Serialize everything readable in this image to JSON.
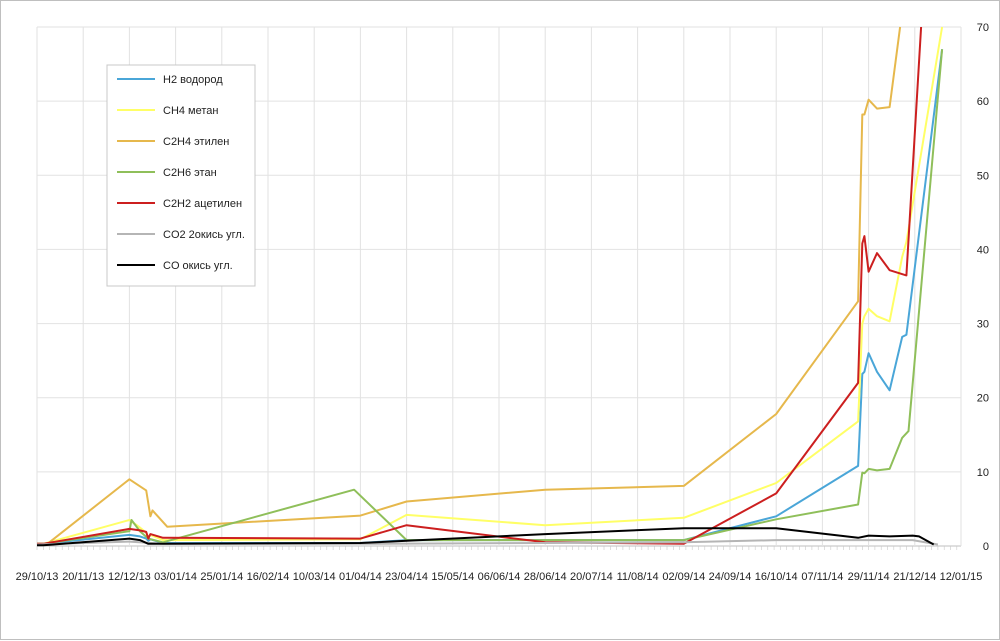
{
  "chart_data": {
    "type": "line",
    "title": "",
    "xlabel": "",
    "ylabel": "",
    "ylim": [
      0,
      70
    ],
    "yticks": [
      0,
      10,
      20,
      30,
      40,
      50,
      60,
      70
    ],
    "y_axis_side": "right",
    "grid": true,
    "legend_position": "top-left",
    "x_tick_labels": [
      "29/10/13",
      "20/11/13",
      "12/12/13",
      "03/01/14",
      "25/01/14",
      "16/02/14",
      "10/03/14",
      "01/04/14",
      "23/04/14",
      "15/05/14",
      "06/06/14",
      "28/06/14",
      "20/07/14",
      "11/08/14",
      "02/09/14",
      "24/09/14",
      "16/10/14",
      "07/11/14",
      "29/11/14",
      "21/12/14",
      "12/01/15"
    ],
    "series": [
      {
        "name": "H2 водород",
        "color": "#4aa6d8",
        "points": [
          [
            "2013-10-29",
            0.3
          ],
          [
            "2013-11-01",
            0.3
          ],
          [
            "2013-12-12",
            1.5
          ],
          [
            "2013-12-17",
            1.3
          ],
          [
            "2013-12-20",
            1.0
          ],
          [
            "2013-12-21",
            0.7
          ],
          [
            "2013-12-22",
            0.9
          ],
          [
            "2013-12-28",
            0.4
          ],
          [
            "2014-04-01",
            0.4
          ],
          [
            "2014-04-23",
            0.8
          ],
          [
            "2014-09-02",
            0.8
          ],
          [
            "2014-10-16",
            4.0
          ],
          [
            "2014-11-24",
            10.8
          ],
          [
            "2014-11-26",
            23.2
          ],
          [
            "2014-11-27",
            23.5
          ],
          [
            "2014-11-29",
            26.0
          ],
          [
            "2014-12-03",
            23.5
          ],
          [
            "2014-12-09",
            21.0
          ],
          [
            "2014-12-15",
            28.2
          ],
          [
            "2014-12-17",
            28.5
          ],
          [
            "2015-01-03",
            67.0
          ]
        ]
      },
      {
        "name": "CH4 метан",
        "color": "#ffff66",
        "points": [
          [
            "2013-10-29",
            0.3
          ],
          [
            "2013-11-01",
            0.3
          ],
          [
            "2013-12-12",
            3.5
          ],
          [
            "2013-12-17",
            2.5
          ],
          [
            "2013-12-20",
            1.8
          ],
          [
            "2013-12-21",
            1.2
          ],
          [
            "2013-12-22",
            1.5
          ],
          [
            "2013-12-28",
            0.8
          ],
          [
            "2014-04-01",
            0.9
          ],
          [
            "2014-04-23",
            4.2
          ],
          [
            "2014-06-28",
            2.8
          ],
          [
            "2014-09-02",
            3.8
          ],
          [
            "2014-10-16",
            8.5
          ],
          [
            "2014-11-24",
            16.8
          ],
          [
            "2014-11-26",
            30.0
          ],
          [
            "2014-11-27",
            31.0
          ],
          [
            "2014-11-29",
            32.0
          ],
          [
            "2014-12-03",
            31.0
          ],
          [
            "2014-12-09",
            30.3
          ],
          [
            "2014-12-15",
            39.0
          ],
          [
            "2014-12-17",
            41.0
          ],
          [
            "2015-01-03",
            70.0
          ]
        ]
      },
      {
        "name": "C2H4 этилен",
        "color": "#e6b84c",
        "points": [
          [
            "2013-10-29",
            0.3
          ],
          [
            "2013-11-03",
            0.3
          ],
          [
            "2013-12-12",
            9.0
          ],
          [
            "2013-12-20",
            7.5
          ],
          [
            "2013-12-22",
            4.0
          ],
          [
            "2013-12-23",
            4.8
          ],
          [
            "2013-12-30",
            2.6
          ],
          [
            "2014-04-01",
            4.1
          ],
          [
            "2014-04-23",
            6.0
          ],
          [
            "2014-06-28",
            7.6
          ],
          [
            "2014-09-02",
            8.1
          ],
          [
            "2014-10-16",
            17.8
          ],
          [
            "2014-11-24",
            33.0
          ],
          [
            "2014-11-26",
            58.2
          ],
          [
            "2014-11-27",
            58.2
          ],
          [
            "2014-11-29",
            60.2
          ],
          [
            "2014-12-03",
            59.0
          ],
          [
            "2014-12-09",
            59.2
          ],
          [
            "2014-12-14",
            70.0
          ]
        ]
      },
      {
        "name": "C2H6 этан",
        "color": "#8fbf5a",
        "points": [
          [
            "2013-10-29",
            0.3
          ],
          [
            "2013-11-01",
            0.3
          ],
          [
            "2013-12-12",
            2.0
          ],
          [
            "2013-12-13",
            3.5
          ],
          [
            "2013-12-17",
            2.0
          ],
          [
            "2013-12-21",
            1.0
          ],
          [
            "2013-12-28",
            0.5
          ],
          [
            "2014-03-29",
            7.6
          ],
          [
            "2014-04-23",
            0.8
          ],
          [
            "2014-09-02",
            0.8
          ],
          [
            "2014-10-16",
            3.6
          ],
          [
            "2014-11-24",
            5.6
          ],
          [
            "2014-11-26",
            9.9
          ],
          [
            "2014-11-27",
            9.8
          ],
          [
            "2014-11-29",
            10.4
          ],
          [
            "2014-12-03",
            10.2
          ],
          [
            "2014-12-09",
            10.4
          ],
          [
            "2014-12-15",
            14.6
          ],
          [
            "2014-12-18",
            15.5
          ],
          [
            "2015-01-03",
            67.0
          ]
        ]
      },
      {
        "name": "C2H2 ацетилен",
        "color": "#cc1f1f",
        "points": [
          [
            "2013-10-29",
            0.3
          ],
          [
            "2013-11-01",
            0.3
          ],
          [
            "2013-12-12",
            2.3
          ],
          [
            "2013-12-17",
            2.1
          ],
          [
            "2013-12-20",
            1.9
          ],
          [
            "2013-12-21",
            1.0
          ],
          [
            "2013-12-22",
            1.6
          ],
          [
            "2013-12-28",
            1.1
          ],
          [
            "2014-04-01",
            1.0
          ],
          [
            "2014-04-23",
            2.8
          ],
          [
            "2014-06-28",
            0.5
          ],
          [
            "2014-09-02",
            0.3
          ],
          [
            "2014-10-16",
            7.1
          ],
          [
            "2014-11-24",
            22.0
          ],
          [
            "2014-11-26",
            40.8
          ],
          [
            "2014-11-27",
            41.8
          ],
          [
            "2014-11-29",
            37.0
          ],
          [
            "2014-12-03",
            39.5
          ],
          [
            "2014-12-09",
            37.2
          ],
          [
            "2014-12-17",
            36.5
          ],
          [
            "2014-12-24",
            70.0
          ]
        ]
      },
      {
        "name": "CO2 2окись угл.",
        "color": "#b5b5b5",
        "points": [
          [
            "2013-10-29",
            0.2
          ],
          [
            "2013-12-12",
            0.6
          ],
          [
            "2013-12-28",
            0.3
          ],
          [
            "2014-04-01",
            0.3
          ],
          [
            "2014-06-28",
            0.4
          ],
          [
            "2014-09-02",
            0.5
          ],
          [
            "2014-10-16",
            0.8
          ],
          [
            "2014-11-24",
            0.8
          ],
          [
            "2014-12-20",
            0.8
          ],
          [
            "2015-01-01",
            0.2
          ]
        ]
      },
      {
        "name": "CO окись угл.",
        "color": "#000000",
        "points": [
          [
            "2013-10-29",
            0.1
          ],
          [
            "2013-11-01",
            0.1
          ],
          [
            "2013-12-12",
            1.0
          ],
          [
            "2013-12-17",
            0.8
          ],
          [
            "2013-12-21",
            0.3
          ],
          [
            "2013-12-28",
            0.3
          ],
          [
            "2014-04-01",
            0.4
          ],
          [
            "2014-06-28",
            1.6
          ],
          [
            "2014-09-02",
            2.4
          ],
          [
            "2014-10-16",
            2.4
          ],
          [
            "2014-11-24",
            1.1
          ],
          [
            "2014-11-29",
            1.4
          ],
          [
            "2014-12-09",
            1.3
          ],
          [
            "2014-12-20",
            1.4
          ],
          [
            "2014-12-23",
            1.3
          ],
          [
            "2014-12-30",
            0.2
          ]
        ]
      }
    ]
  }
}
